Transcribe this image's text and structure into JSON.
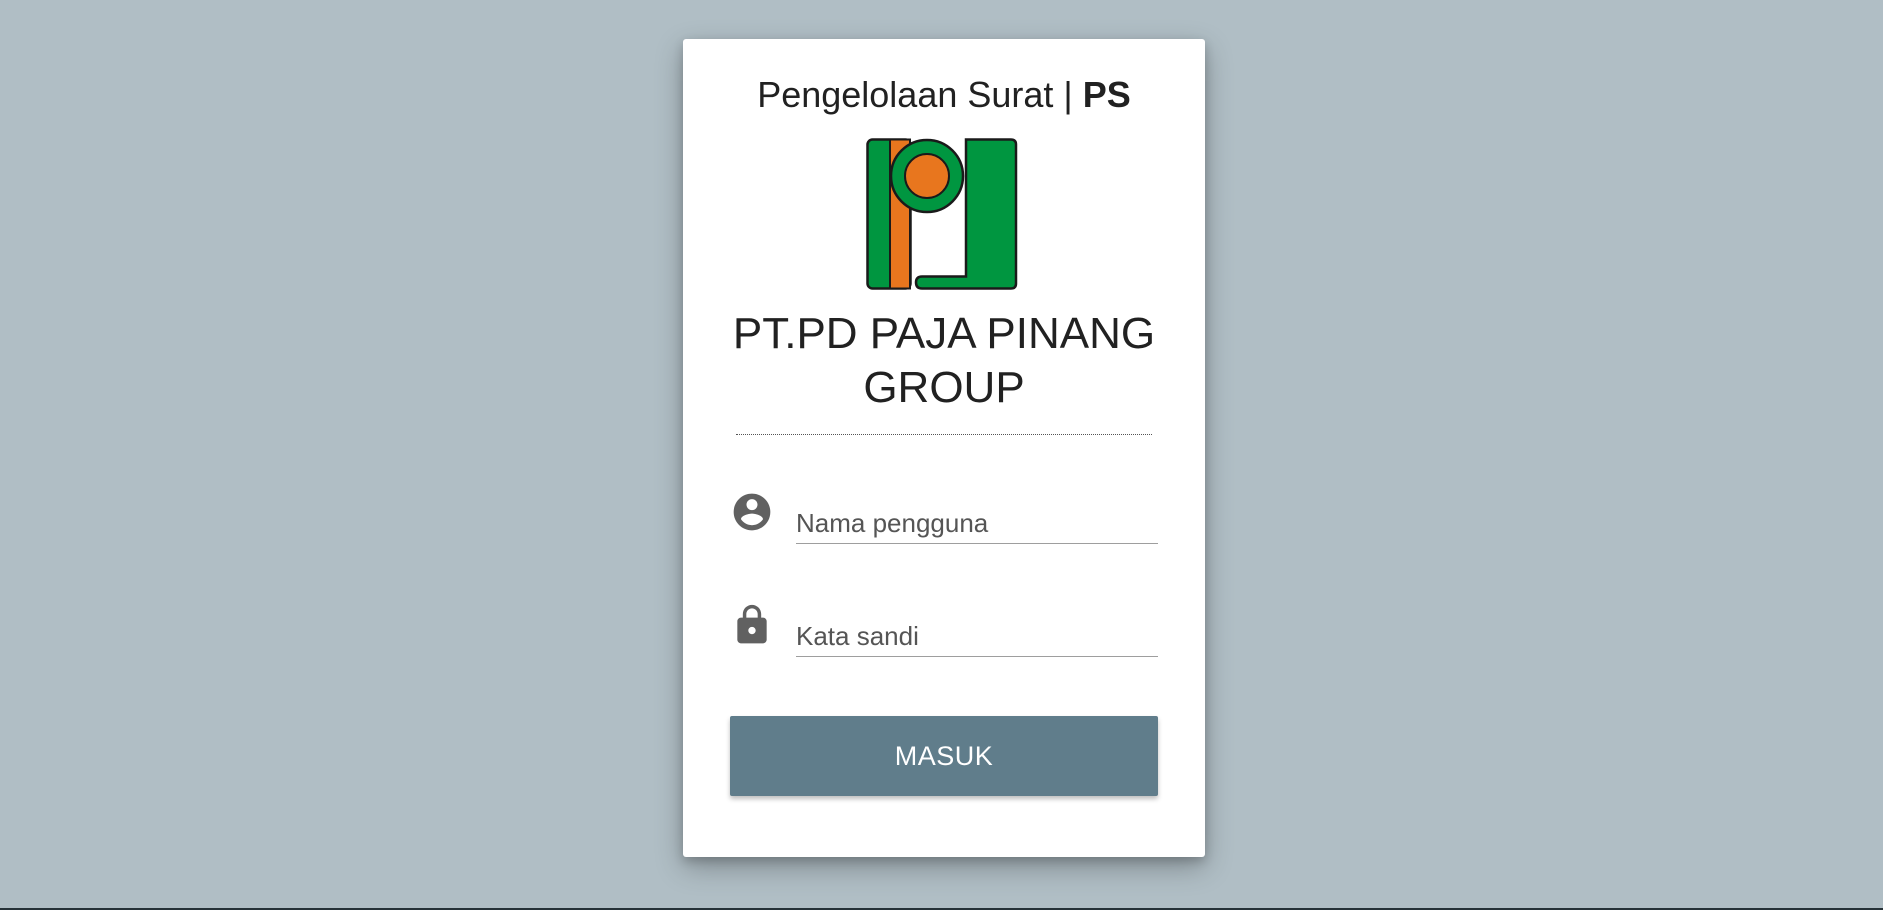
{
  "header": {
    "app_title": "Pengelolaan Surat | ",
    "app_abbr": "PS"
  },
  "logo": {
    "icon": "company-logo",
    "colors": {
      "green": "#009640",
      "orange": "#e8761e",
      "outline": "#1a1a1a"
    }
  },
  "company": {
    "name": "PT.PD PAJA PINANG GROUP"
  },
  "form": {
    "username": {
      "icon": "account-circle-icon",
      "placeholder": "Nama pengguna",
      "value": ""
    },
    "password": {
      "icon": "lock-icon",
      "placeholder": "Kata sandi",
      "value": ""
    },
    "submit_label": "MASUK"
  },
  "colors": {
    "background": "#b0bec5",
    "button": "#607d8b",
    "icon": "#616161"
  }
}
